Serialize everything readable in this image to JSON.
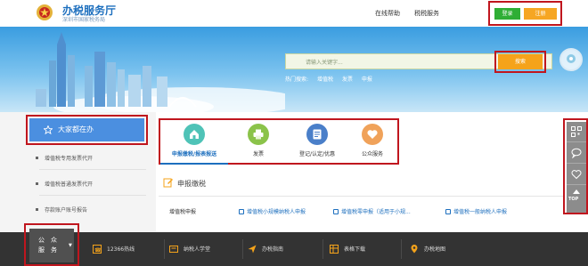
{
  "header": {
    "title": "办税服务厅",
    "subtitle": "深圳市国家税务局",
    "nav": [
      "在线帮助",
      "税税服务"
    ],
    "login_label": "登录",
    "register_label": "注册"
  },
  "banner": {
    "search_placeholder": "请输入关键字...",
    "search_button": "搜索",
    "hot_label": "热门搜索:",
    "hot_terms": [
      "增值税",
      "发票",
      "申报"
    ]
  },
  "sidebar": {
    "heading": "大家都在办",
    "items": [
      "增值税专用发票代开",
      "增值税普通发票代开",
      "存款账户账号报告"
    ]
  },
  "tiles": [
    {
      "label": "申报缴税/报表报送",
      "icon": "home-doc-icon",
      "color": "#4fc3b7"
    },
    {
      "label": "发票",
      "icon": "printer-icon",
      "color": "#8bc34a"
    },
    {
      "label": "登记/认定/优惠",
      "icon": "registration-icon",
      "color": "#4a7fc9"
    },
    {
      "label": "公众服务",
      "icon": "heart-icon",
      "color": "#f0a25a"
    }
  ],
  "panel": {
    "title": "申报缴税",
    "row_label": "增值税申报",
    "links": [
      "增值税小规模纳税人申报",
      "增值税零申报（适用于小规...",
      "增值税一般纳税人申报"
    ]
  },
  "float_toolbar": {
    "top_label": "TOP"
  },
  "bottom": {
    "public_service": [
      "公　众",
      "服　务"
    ],
    "items": [
      {
        "label": "12366热线",
        "icon": "hotline-icon"
      },
      {
        "label": "纳税人学堂",
        "icon": "classroom-icon"
      },
      {
        "label": "办税指南",
        "icon": "guide-icon"
      },
      {
        "label": "表格下载",
        "icon": "download-icon"
      },
      {
        "label": "办税地图",
        "icon": "map-pin-icon"
      }
    ]
  },
  "colors": {
    "brand_blue": "#1d6fbe",
    "login_green": "#2fae35",
    "accent_orange": "#f5a31a",
    "highlight_red": "#c0161e"
  }
}
